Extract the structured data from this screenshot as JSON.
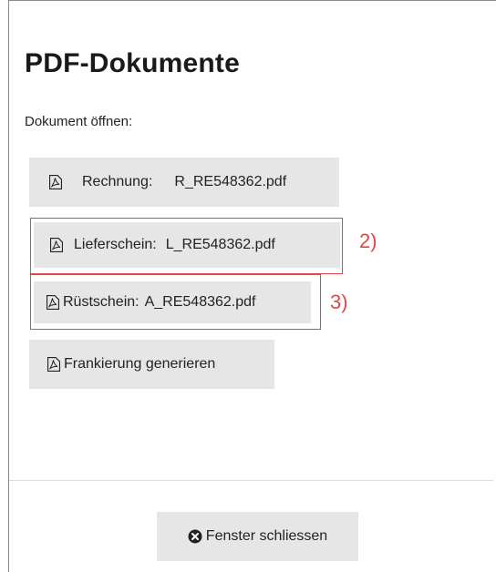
{
  "dialog": {
    "title": "PDF-Dokumente",
    "subtitle": "Dokument öffnen:"
  },
  "documents": [
    {
      "label": "Rechnung:",
      "file": "R_RE548362.pdf",
      "icon": "pdf-file-icon"
    },
    {
      "label": "Lieferschein:",
      "file": "L_RE548362.pdf",
      "icon": "pdf-file-icon"
    },
    {
      "label": "Rüstschein:",
      "file": "A_RE548362.pdf",
      "icon": "pdf-file-icon"
    },
    {
      "label": "Frankierung generieren",
      "icon": "pdf-file-icon"
    }
  ],
  "annotations": [
    {
      "label": "2)",
      "color": "#e04848"
    },
    {
      "label": "3)",
      "color": "#e04848"
    }
  ],
  "footer": {
    "close_label": "Fenster schliessen",
    "close_icon": "close-circle-icon"
  },
  "colors": {
    "button_bg": "#e6e6e6",
    "annotation": "#e04848"
  }
}
